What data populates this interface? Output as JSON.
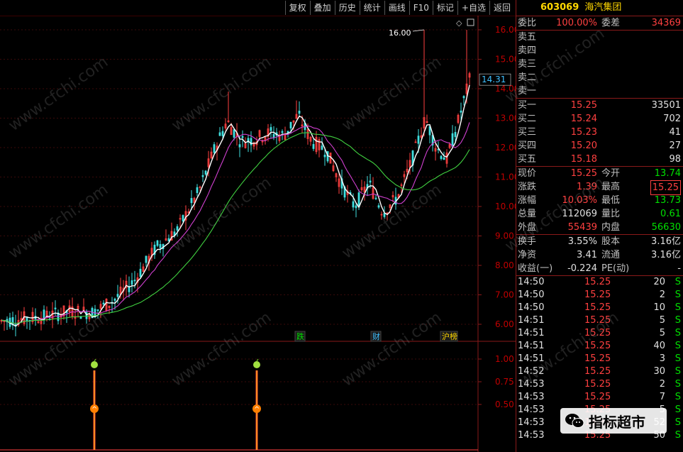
{
  "toolbar": [
    "复权",
    "叠加",
    "历史",
    "统计",
    "画线",
    "F10",
    "标记",
    "+自选",
    "返回"
  ],
  "stock": {
    "code": "603069",
    "name": "海汽集团"
  },
  "axis_labels": [
    "16.00",
    "15.00",
    "14.00",
    "13.00",
    "12.00",
    "11.00",
    "10.00",
    "9.00",
    "8.00",
    "7.00",
    "6.00"
  ],
  "current_price_tag": "14.31",
  "high_annotation": "16.00",
  "markers": [
    {
      "label": "跌",
      "color": "#00e000"
    },
    {
      "label": "财",
      "color": "#40c0ff"
    },
    {
      "label": "沪榜",
      "color": "#ffd700"
    }
  ],
  "sub_axis_labels": [
    "1.00",
    "0.75",
    "0.50"
  ],
  "panel": {
    "weibi_label": "委比",
    "weibi_val": "100.00%",
    "weicha_label": "委差",
    "weicha_val": "34369",
    "sells": [
      {
        "label": "卖五",
        "price": "",
        "vol": ""
      },
      {
        "label": "卖四",
        "price": "",
        "vol": ""
      },
      {
        "label": "卖三",
        "price": "",
        "vol": ""
      },
      {
        "label": "卖二",
        "price": "",
        "vol": ""
      },
      {
        "label": "卖一",
        "price": "",
        "vol": ""
      }
    ],
    "buys": [
      {
        "label": "买一",
        "price": "15.25",
        "vol": "33501"
      },
      {
        "label": "买二",
        "price": "15.24",
        "vol": "702"
      },
      {
        "label": "买三",
        "price": "15.23",
        "vol": "41"
      },
      {
        "label": "买四",
        "price": "15.20",
        "vol": "27"
      },
      {
        "label": "买五",
        "price": "15.18",
        "vol": "98"
      }
    ],
    "quotes": [
      {
        "l1": "现价",
        "v1": "15.25",
        "c1": "red",
        "l2": "今开",
        "v2": "13.74",
        "c2": "green"
      },
      {
        "l1": "涨跌",
        "v1": "1.39",
        "c1": "red",
        "l2": "最高",
        "v2": "15.25",
        "c2": "red",
        "box": true
      },
      {
        "l1": "涨幅",
        "v1": "10.03%",
        "c1": "red",
        "l2": "最低",
        "v2": "13.73",
        "c2": "green"
      },
      {
        "l1": "总量",
        "v1": "112069",
        "c1": "white",
        "l2": "量比",
        "v2": "0.61",
        "c2": "green"
      },
      {
        "l1": "外盘",
        "v1": "55439",
        "c1": "red",
        "l2": "内盘",
        "v2": "56630",
        "c2": "green"
      }
    ],
    "fund": [
      {
        "l1": "换手",
        "v1": "3.55%",
        "l2": "股本",
        "v2": "3.16亿"
      },
      {
        "l1": "净资",
        "v1": "3.41",
        "l2": "流通",
        "v2": "3.16亿"
      },
      {
        "l1": "收益(一)",
        "v1": "-0.224",
        "l2": "PE(动)",
        "v2": "-"
      }
    ],
    "ticks": [
      {
        "t": "14:50",
        "p": "15.25",
        "v": "20",
        "s": "S"
      },
      {
        "t": "14:50",
        "p": "15.25",
        "v": "2",
        "s": "S"
      },
      {
        "t": "14:50",
        "p": "15.25",
        "v": "10",
        "s": "S"
      },
      {
        "t": "14:51",
        "p": "15.25",
        "v": "5",
        "s": "S"
      },
      {
        "t": "14:51",
        "p": "15.25",
        "v": "5",
        "s": "S"
      },
      {
        "t": "14:51",
        "p": "15.25",
        "v": "40",
        "s": "S"
      },
      {
        "t": "14:51",
        "p": "15.25",
        "v": "3",
        "s": "S"
      },
      {
        "t": "14:52",
        "p": "15.25",
        "v": "30",
        "s": "S"
      },
      {
        "t": "14:53",
        "p": "15.25",
        "v": "2",
        "s": "S"
      },
      {
        "t": "14:53",
        "p": "15.25",
        "v": "7",
        "s": "S"
      },
      {
        "t": "14:53",
        "p": "15.25",
        "v": "5",
        "s": "S"
      },
      {
        "t": "14:53",
        "p": "15.25",
        "v": "52",
        "s": "S"
      },
      {
        "t": "14:53",
        "p": "15.25",
        "v": "50",
        "s": "S"
      }
    ]
  },
  "watermark": "www.cfchi.com",
  "wechat_label": "指标超市",
  "colors": {
    "up": "#ff4040",
    "down": "#00e000",
    "ma_white": "#ffffff",
    "ma_purple": "#d040d0",
    "ma_green": "#40d040",
    "border": "#8a1a1a"
  }
}
